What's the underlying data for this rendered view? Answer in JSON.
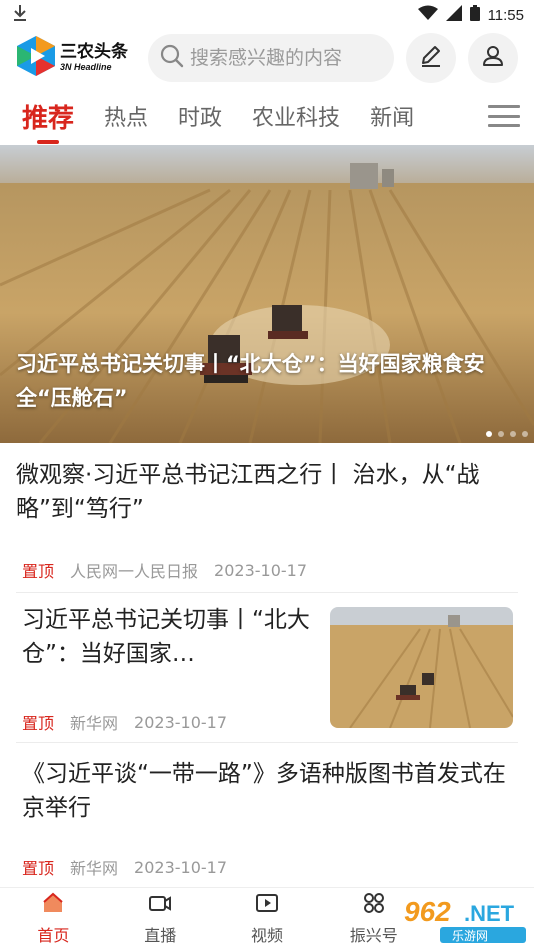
{
  "status_bar": {
    "time": "11:55"
  },
  "header": {
    "logo_cn": "三农头条",
    "logo_en": "3N Headline",
    "search_placeholder": "搜索感兴趣的内容"
  },
  "tabs": [
    {
      "label": "推荐",
      "active": true
    },
    {
      "label": "热点",
      "active": false
    },
    {
      "label": "时政",
      "active": false
    },
    {
      "label": "农业科技",
      "active": false
    },
    {
      "label": "新闻",
      "active": false
    }
  ],
  "banner": {
    "caption": "习近平总书记关切事丨“北大仓”：当好国家粮食安全“压舱石”",
    "slide_count": 4,
    "current_slide": 1
  },
  "news": [
    {
      "title": "微观察·习近平总书记江西之行丨 治水，从“战略”到“笃行”",
      "pin": "置顶",
      "source": "人民网一人民日报",
      "date": "2023-10-17"
    },
    {
      "title": "习近平总书记关切事丨“北大仓”：当好国家…",
      "pin": "置顶",
      "source": "新华网",
      "date": "2023-10-17"
    },
    {
      "title": "《习近平谈“一带一路”》多语种版图书首发式在京举行",
      "pin": "置顶",
      "source": "新华网",
      "date": "2023-10-17"
    }
  ],
  "bottom_nav": [
    {
      "label": "首页",
      "icon": "home-icon",
      "active": true
    },
    {
      "label": "直播",
      "icon": "live-icon",
      "active": false
    },
    {
      "label": "视频",
      "icon": "video-icon",
      "active": false
    },
    {
      "label": "振兴号",
      "icon": "revival-icon",
      "active": false
    }
  ],
  "watermark": "962.NET 乐游网",
  "colors": {
    "accent": "#d8261d",
    "search_bg": "#f2f2f2",
    "meta_text": "#999999"
  }
}
